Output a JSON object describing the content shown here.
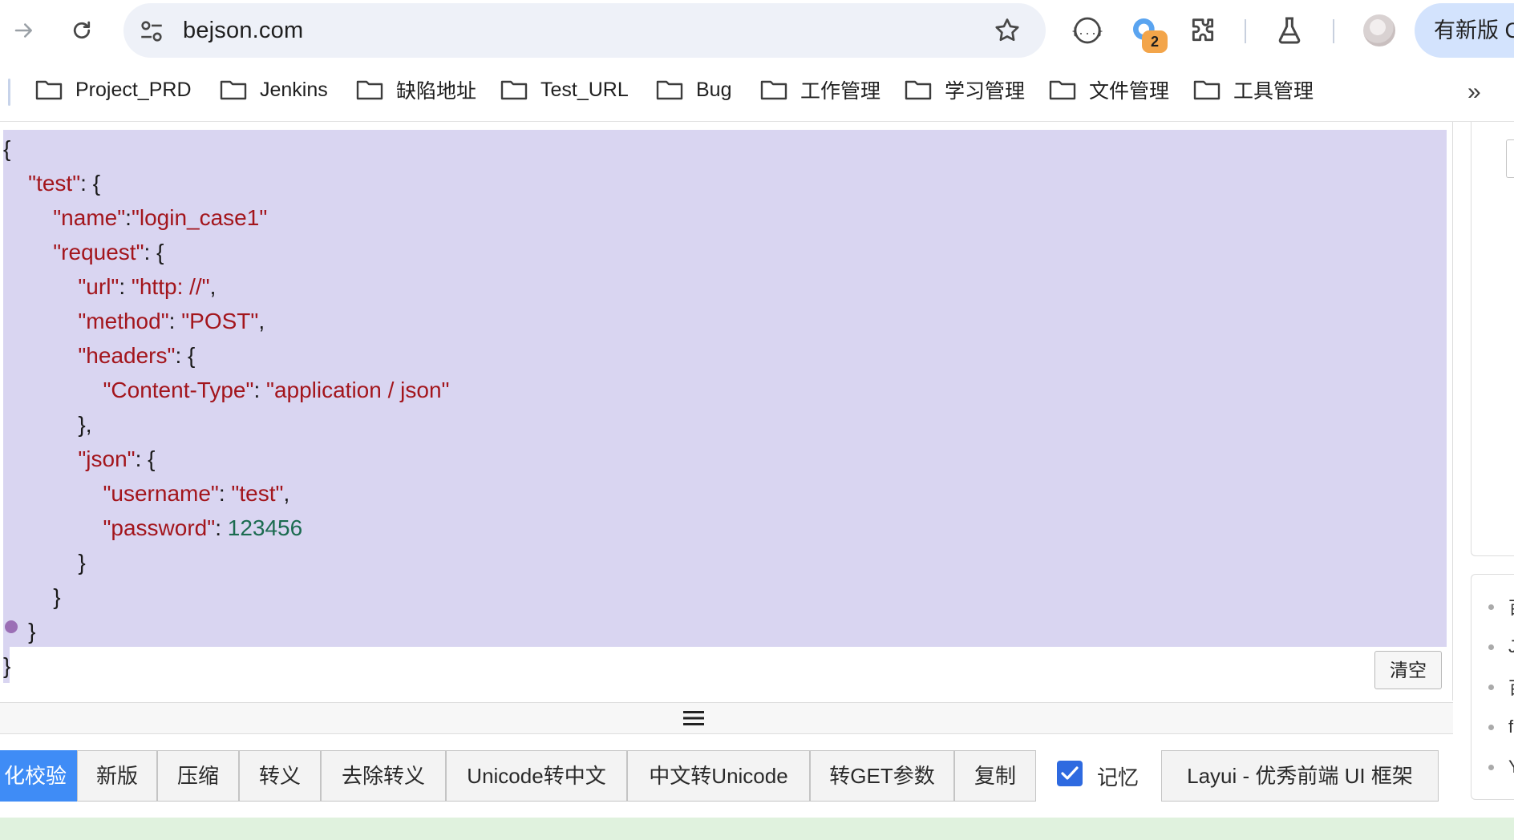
{
  "browser": {
    "url": "bejson.com",
    "extension_badge": "2",
    "update_button": "有新版 C"
  },
  "bookmarks": [
    {
      "label": "Project_PRD"
    },
    {
      "label": "Jenkins"
    },
    {
      "label": "缺陷地址"
    },
    {
      "label": "Test_URL"
    },
    {
      "label": "Bug"
    },
    {
      "label": "工作管理"
    },
    {
      "label": "学习管理"
    },
    {
      "label": "文件管理"
    },
    {
      "label": "工具管理"
    }
  ],
  "bookmarks_more": "»",
  "editor": {
    "lines": [
      "{",
      "    \"test\": {",
      "        \"name\":\"login_case1\"",
      "        \"request\": {",
      "            \"url\": \"http: //\",",
      "            \"method\": \"POST\",",
      "            \"headers\": {",
      "                \"Content-Type\": \"application / json\"",
      "            },",
      "            \"json\": {",
      "                \"username\": \"test\",",
      "                \"password\": 123456",
      "            }",
      "        }",
      "    }",
      "}"
    ],
    "clear_label": "清空"
  },
  "actions": [
    {
      "label": "化校验",
      "primary": true
    },
    {
      "label": "新版"
    },
    {
      "label": "压缩"
    },
    {
      "label": "转义"
    },
    {
      "label": "去除转义"
    },
    {
      "label": "Unicode转中文"
    },
    {
      "label": "中文转Unicode"
    },
    {
      "label": "转GET参数"
    },
    {
      "label": "复制"
    }
  ],
  "memory": {
    "label": "记忆",
    "checked": true
  },
  "layui_link": "Layui - 优秀前端 UI 框架",
  "side_list": [
    "百",
    "J",
    "百",
    "f",
    "Y"
  ],
  "colors": {
    "selection": "#d9d5f1",
    "key": "#a3151c",
    "number": "#1b6b50",
    "primary": "#3f8cf6"
  }
}
